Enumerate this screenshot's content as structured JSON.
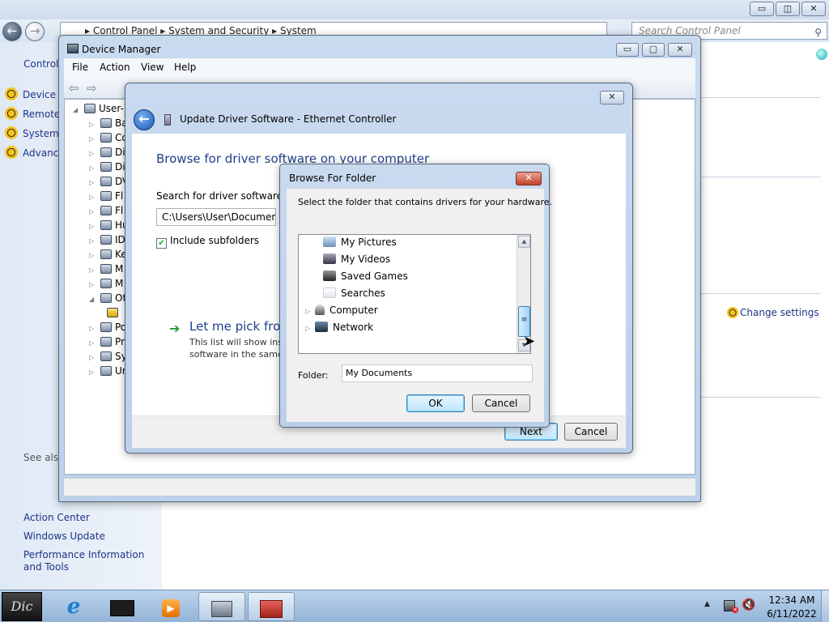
{
  "control_panel": {
    "address_crumbs": [
      "Control Panel",
      "System and Security",
      "System"
    ],
    "search_placeholder": "Search Control Panel",
    "left_title": "Control",
    "tasks": [
      "Device M",
      "Remote",
      "System",
      "Advanc"
    ],
    "see_also": "See also",
    "links": [
      "Action Center",
      "Windows Update",
      "Performance Information and Tools"
    ],
    "change_settings": "Change settings",
    "caption_buttons": [
      "▭",
      "◫",
      "✕"
    ]
  },
  "device_manager": {
    "title": "Device Manager",
    "menu": [
      "File",
      "Action",
      "View",
      "Help"
    ],
    "tree_root": "User-I",
    "tree_items": [
      "Ba",
      "Co",
      "Di",
      "Di",
      "DV",
      "Fl",
      "Fl",
      "Hu",
      "ID",
      "Ke",
      "M",
      "M",
      "Ot",
      "",
      "Po",
      "Pr",
      "Sy",
      "Ur"
    ],
    "caption_buttons": [
      "▭",
      "▢",
      "✕"
    ]
  },
  "update_driver": {
    "title": "Update Driver Software - Ethernet Controller",
    "heading": "Browse for driver software on your computer",
    "search_label": "Search for driver software in",
    "path_value": "C:\\Users\\User\\Documents",
    "include_subfolders": "Include subfolders",
    "include_subfolders_checked": true,
    "pick_title": "Let me pick from",
    "pick_desc": "This list will show inst software in the same",
    "next_button": "Next",
    "cancel_button": "Cancel",
    "close_button": "✕"
  },
  "browse_folder": {
    "title": "Browse For Folder",
    "description": "Select the folder that contains drivers for your hardware.",
    "tree": [
      {
        "label": "My Pictures",
        "icon": "pictures-icon",
        "indent": 1,
        "expander": false
      },
      {
        "label": "My Videos",
        "icon": "videos-icon",
        "indent": 1,
        "expander": false
      },
      {
        "label": "Saved Games",
        "icon": "saved-games-icon",
        "indent": 1,
        "expander": false
      },
      {
        "label": "Searches",
        "icon": "searches-icon",
        "indent": 1,
        "expander": false
      },
      {
        "label": "Computer",
        "icon": "computer-icon",
        "indent": 0,
        "expander": true
      },
      {
        "label": "Network",
        "icon": "network-icon",
        "indent": 0,
        "expander": true
      }
    ],
    "folder_label": "Folder:",
    "folder_value": "My Documents",
    "ok_button": "OK",
    "cancel_button": "Cancel",
    "close_button": "✕"
  },
  "taskbar": {
    "start_label": "Dic",
    "items": [
      {
        "name": "internet-explorer-icon",
        "glyph": "e",
        "color": "#1b7fd6",
        "active": false
      },
      {
        "name": "media-center-icon",
        "glyph": "▬",
        "color": "#222222",
        "active": false
      },
      {
        "name": "media-player-icon",
        "glyph": "▶",
        "color": "#f08a1c",
        "active": false
      },
      {
        "name": "system-app-icon",
        "glyph": "▦",
        "color": "#5a6b7d",
        "active": true
      },
      {
        "name": "device-manager-taskbar-icon",
        "glyph": "▣",
        "color": "#c0392b",
        "active": true
      }
    ],
    "clock_time": "12:34 AM",
    "clock_date": "6/11/2022"
  }
}
